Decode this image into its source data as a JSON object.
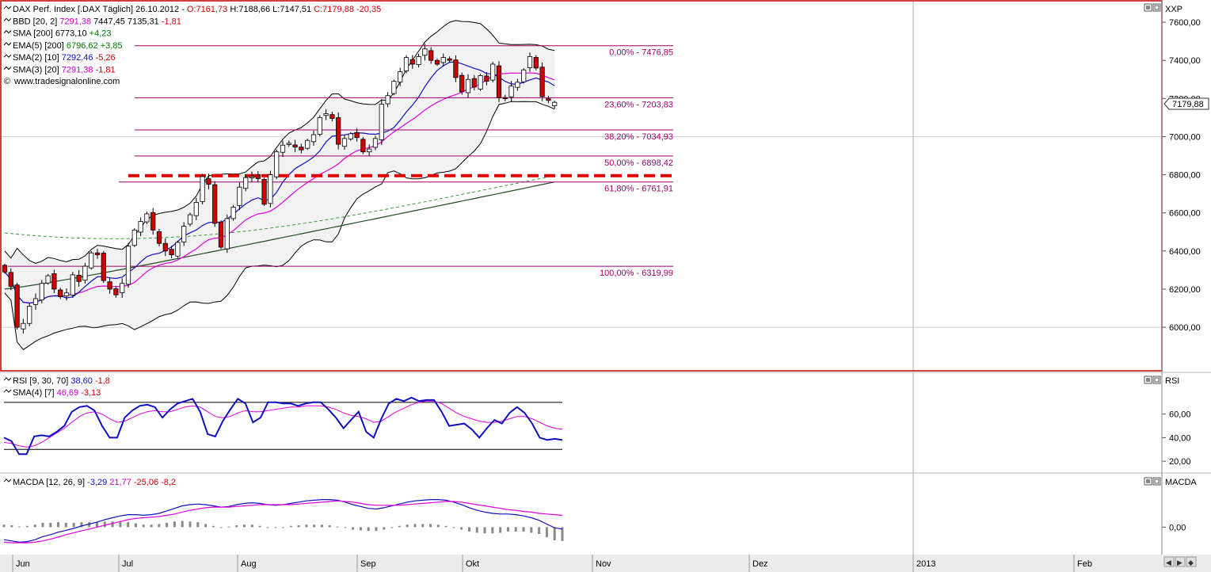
{
  "main_panel": {
    "legend": [
      {
        "prefix": "DAX Perf. Index [.DAX  Täglich] 26.10.2012 - ",
        "parts": [
          {
            "t": "O:7161,73 ",
            "c": "#d10000"
          },
          {
            "t": "H:7188,66 L:7147,51 ",
            "c": "#000000"
          },
          {
            "t": "C:7179,88 -20,35",
            "c": "#d10000"
          }
        ]
      },
      {
        "prefix": "BBD [20, 2] ",
        "parts": [
          {
            "t": "7291,38 ",
            "c": "#c800c8"
          },
          {
            "t": "7447,45 7135,31 ",
            "c": "#000000"
          },
          {
            "t": "-1,81",
            "c": "#d10000"
          }
        ]
      },
      {
        "prefix": "SMA [200] ",
        "parts": [
          {
            "t": "6773,10 ",
            "c": "#000000"
          },
          {
            "t": "+4,23",
            "c": "#007a00"
          }
        ]
      },
      {
        "prefix": "EMA(5) [200] ",
        "parts": [
          {
            "t": "6796,62 ",
            "c": "#007a00"
          },
          {
            "t": "+3,85",
            "c": "#007a00"
          }
        ]
      },
      {
        "prefix": "SMA(2) [10] ",
        "parts": [
          {
            "t": "7292,46 ",
            "c": "#1010c0"
          },
          {
            "t": "-5,26",
            "c": "#d10000"
          }
        ]
      },
      {
        "prefix": "SMA(3) [20] ",
        "parts": [
          {
            "t": "7291,38 ",
            "c": "#c800c8"
          },
          {
            "t": "-1,81",
            "c": "#d10000"
          }
        ]
      }
    ],
    "source": "www.tradesignalonline.com",
    "axis_title": "XXP",
    "price_tag": "7179,88"
  },
  "rsi_panel": {
    "legend": [
      {
        "prefix": "RSI [9, 30, 70] ",
        "parts": [
          {
            "t": "38,60 ",
            "c": "#1010c0"
          },
          {
            "t": "-1,8",
            "c": "#d10000"
          }
        ]
      },
      {
        "prefix": "SMA(4) [7] ",
        "parts": [
          {
            "t": "46,69 ",
            "c": "#c800c8"
          },
          {
            "t": "-3,13",
            "c": "#d10000"
          }
        ]
      }
    ],
    "axis_title": "RSI"
  },
  "macd_panel": {
    "legend": [
      {
        "prefix": "MACDA [12, 26, 9] ",
        "parts": [
          {
            "t": "-3,29 ",
            "c": "#1010c0"
          },
          {
            "t": "21,77 ",
            "c": "#c800c8"
          },
          {
            "t": "-25,06 -8,2",
            "c": "#d10000"
          }
        ]
      }
    ],
    "axis_title": "MACDA"
  },
  "colors": {
    "up_candle": "#ffffff",
    "down_candle": "#d00000",
    "bollinger_fill": "#f2f2f2",
    "fib_line": "#a0006a",
    "support_dash": "#e00000",
    "sma200": "#1f4d1f",
    "ema200": "#3a9a3a",
    "sma10": "#1010c0",
    "sma20": "#e000e0",
    "panel_border": "#c00000"
  },
  "chart_data": [
    {
      "type": "candlestick",
      "title": "DAX Perf. Index [.DAX  Täglich] 26.10.2012",
      "x_tick_labels": [
        "Jun",
        "Jul",
        "Aug",
        "Sep",
        "Okt",
        "Nov",
        "Dez",
        "2013",
        "Feb"
      ],
      "y_tick_labels": [
        "6000,00",
        "6200,00",
        "6400,00",
        "6600,00",
        "6800,00",
        "7000,00",
        "7200,00",
        "7400,00",
        "7600,00"
      ],
      "ylim": [
        5780,
        7700
      ],
      "grid": true,
      "fibonacci_levels": [
        {
          "label": "0,00% - 7476,85",
          "value": 7476.85
        },
        {
          "label": "23,60% - 7203,83",
          "value": 7203.83
        },
        {
          "label": "38,20% - 7034,93",
          "value": 7034.93
        },
        {
          "label": "50,00% - 6898,42",
          "value": 6898.42
        },
        {
          "label": "61,80% - 6761,91",
          "value": 6761.91
        },
        {
          "label": "100,00% - 6319,99",
          "value": 6319.99
        }
      ],
      "support_line": 6795,
      "last": {
        "open": 7161.73,
        "high": 7188.66,
        "low": 7147.51,
        "close": 7179.88,
        "date": "26.10.2012"
      },
      "close_series": [
        6290,
        6215,
        6000,
        6020,
        6110,
        6150,
        6230,
        6270,
        6200,
        6160,
        6180,
        6275,
        6240,
        6320,
        6390,
        6380,
        6245,
        6200,
        6170,
        6230,
        6425,
        6510,
        6555,
        6595,
        6510,
        6440,
        6400,
        6380,
        6445,
        6530,
        6590,
        6655,
        6790,
        6750,
        6545,
        6420,
        6570,
        6630,
        6735,
        6785,
        6790,
        6780,
        6645,
        6800,
        6920,
        6955,
        6965,
        6945,
        6930,
        6980,
        7010,
        7100,
        7120,
        7095,
        6960,
        6990,
        7015,
        6995,
        6920,
        6935,
        6990,
        7170,
        7215,
        7290,
        7340,
        7415,
        7380,
        7420,
        7460,
        7400,
        7380,
        7415,
        7400,
        7310,
        7235,
        7300,
        7260,
        7320,
        7290,
        7380,
        7205,
        7200,
        7265,
        7285,
        7350,
        7420,
        7360,
        7210,
        7190,
        7179.88
      ]
    },
    {
      "type": "line",
      "title": "RSI [9, 30, 70]",
      "y_tick_labels": [
        "20,00",
        "40,00",
        "60,00"
      ],
      "ylim": [
        10,
        82
      ],
      "reference_lines": [
        30,
        70
      ],
      "series": [
        {
          "name": "RSI [9, 30, 70]",
          "values": [
            40,
            37,
            26,
            26,
            41,
            42,
            41,
            45,
            50,
            62,
            66,
            67,
            63,
            50,
            40,
            40,
            57,
            63,
            67,
            68,
            66,
            57,
            64,
            69,
            71,
            73,
            62,
            43,
            41,
            54,
            64,
            73,
            69,
            53,
            57,
            70,
            70,
            69,
            69,
            67,
            69,
            70,
            70,
            64,
            57,
            48,
            55,
            62,
            45,
            40,
            56,
            69,
            73,
            71,
            74,
            71,
            72,
            72,
            62,
            50,
            51,
            52,
            47,
            40,
            48,
            55,
            52,
            61,
            66,
            61,
            52,
            40,
            38,
            39,
            38
          ]
        },
        {
          "name": "SMA(4) [7]",
          "values": [
            36,
            35,
            33,
            32,
            33,
            36,
            40,
            44,
            48,
            53,
            58,
            61,
            62,
            60,
            56,
            53,
            54,
            57,
            60,
            62,
            63,
            62,
            62,
            64,
            66,
            67,
            66,
            62,
            58,
            57,
            58,
            61,
            63,
            62,
            62,
            63,
            64,
            65,
            66,
            66,
            67,
            67,
            67,
            66,
            64,
            61,
            59,
            58,
            56,
            53,
            54,
            58,
            62,
            65,
            68,
            70,
            71,
            71,
            69,
            65,
            61,
            58,
            56,
            54,
            53,
            53,
            54,
            56,
            58,
            58,
            56,
            53,
            50,
            48,
            47
          ]
        }
      ]
    },
    {
      "type": "line",
      "title": "MACDA [12, 26, 9]",
      "y_tick_labels": [
        "0,00"
      ],
      "ylim": [
        -40,
        60
      ],
      "series": [
        {
          "name": "MACD",
          "values": [
            -20,
            -22,
            -24,
            -23,
            -20,
            -15,
            -12,
            -8,
            -5,
            -2,
            2,
            5,
            8,
            12,
            15,
            18,
            20,
            20,
            19,
            20,
            22,
            26,
            30,
            34,
            36,
            37,
            36,
            34,
            32,
            33,
            36,
            38,
            39,
            38,
            36,
            35,
            36,
            38,
            40,
            42,
            43,
            44,
            44,
            43,
            40,
            36,
            33,
            30,
            29,
            31,
            34,
            37,
            40,
            42,
            43,
            44,
            44,
            43,
            40,
            36,
            31,
            27,
            24,
            22,
            21,
            21,
            20,
            18,
            15,
            11,
            5,
            -1,
            -3
          ]
        },
        {
          "name": "Signal",
          "values": [
            -24,
            -25,
            -25,
            -25,
            -24,
            -22,
            -19,
            -16,
            -12,
            -9,
            -6,
            -3,
            0,
            3,
            6,
            9,
            12,
            14,
            15,
            16,
            17,
            19,
            21,
            24,
            27,
            29,
            31,
            32,
            32,
            32,
            33,
            34,
            35,
            36,
            36,
            36,
            36,
            36,
            37,
            38,
            39,
            40,
            41,
            42,
            41,
            40,
            38,
            36,
            35,
            35,
            35,
            35,
            36,
            37,
            38,
            39,
            40,
            41,
            41,
            40,
            38,
            36,
            34,
            32,
            30,
            28,
            27,
            25,
            24,
            22,
            21,
            20,
            19
          ]
        },
        {
          "name": "Histogram",
          "values": [
            4,
            3,
            1,
            2,
            4,
            7,
            7,
            8,
            7,
            7,
            8,
            8,
            8,
            9,
            9,
            9,
            8,
            6,
            4,
            4,
            5,
            7,
            9,
            10,
            9,
            8,
            5,
            2,
            0,
            1,
            3,
            4,
            4,
            2,
            0,
            -1,
            0,
            2,
            3,
            4,
            4,
            4,
            3,
            1,
            -1,
            -4,
            -5,
            -6,
            -6,
            -4,
            -1,
            2,
            4,
            5,
            5,
            5,
            4,
            2,
            -1,
            -4,
            -7,
            -9,
            -10,
            -10,
            -9,
            -7,
            -7,
            -7,
            -9,
            -11,
            -16,
            -21,
            -22
          ]
        }
      ]
    }
  ]
}
